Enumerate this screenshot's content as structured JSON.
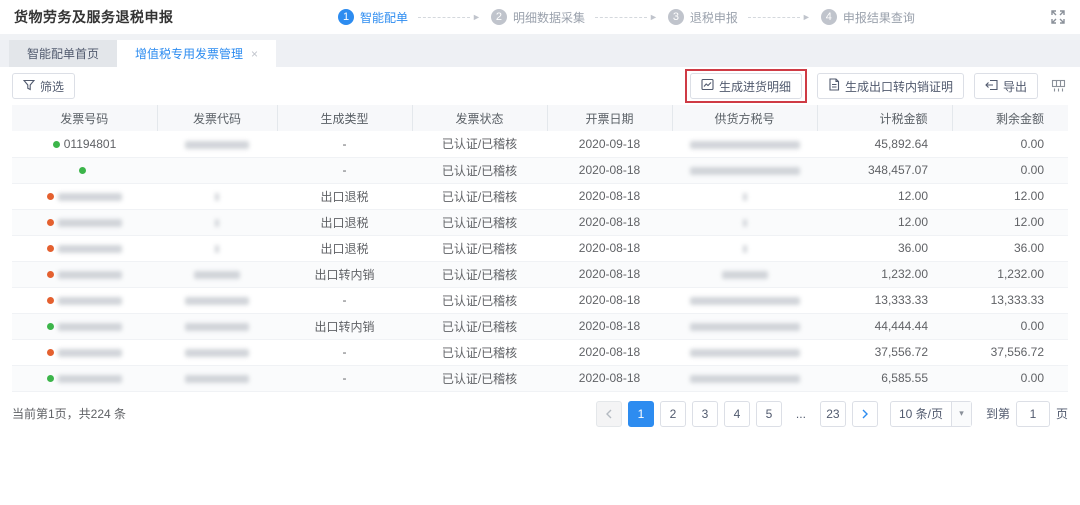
{
  "header": {
    "title": "货物劳务及服务退税申报",
    "steps": [
      {
        "num": "1",
        "label": "智能配单",
        "active": true
      },
      {
        "num": "2",
        "label": "明细数据采集",
        "active": false
      },
      {
        "num": "3",
        "label": "退税申报",
        "active": false
      },
      {
        "num": "4",
        "label": "申报结果查询",
        "active": false
      }
    ]
  },
  "tabs": [
    {
      "label": "智能配单首页",
      "active": false,
      "closable": false
    },
    {
      "label": "增值税专用发票管理",
      "active": true,
      "closable": true
    }
  ],
  "toolbar": {
    "filter_label": "筛选",
    "generate_purchase_label": "生成进货明细",
    "generate_export_label": "生成出口转内销证明",
    "export_label": "导出",
    "highlight_color": "#cf3b45",
    "accent_color": "#2d8cf0"
  },
  "table": {
    "columns": [
      "发票号码",
      "发票代码",
      "生成类型",
      "发票状态",
      "开票日期",
      "供货方税号",
      "计税金额",
      "剩余金额"
    ],
    "rows": [
      {
        "dot": "green",
        "number": {
          "text": "01194801"
        },
        "code": {
          "mask": "medium"
        },
        "type": "-",
        "status": "已认证/已稽核",
        "date": "2020-09-18",
        "supplier": {
          "mask": "long"
        },
        "tax_amount": "45,892.64",
        "remain_amount": "0.00"
      },
      {
        "dot": "green",
        "number": {},
        "code": {},
        "type": "-",
        "status": "已认证/已稽核",
        "date": "2020-08-18",
        "supplier": {
          "mask": "long"
        },
        "tax_amount": "348,457.07",
        "remain_amount": "0.00"
      },
      {
        "dot": "orange",
        "number": {
          "mask": "medium"
        },
        "code": {
          "mask": "tiny"
        },
        "type": "出口退税",
        "status": "已认证/已稽核",
        "date": "2020-08-18",
        "supplier": {
          "mask": "tiny"
        },
        "tax_amount": "12.00",
        "remain_amount": "12.00"
      },
      {
        "dot": "orange",
        "number": {
          "mask": "medium"
        },
        "code": {
          "mask": "tiny"
        },
        "type": "出口退税",
        "status": "已认证/已稽核",
        "date": "2020-08-18",
        "supplier": {
          "mask": "tiny"
        },
        "tax_amount": "12.00",
        "remain_amount": "12.00"
      },
      {
        "dot": "orange",
        "number": {
          "mask": "medium"
        },
        "code": {
          "mask": "tiny"
        },
        "type": "出口退税",
        "status": "已认证/已稽核",
        "date": "2020-08-18",
        "supplier": {
          "mask": "tiny"
        },
        "tax_amount": "36.00",
        "remain_amount": "36.00"
      },
      {
        "dot": "orange",
        "number": {
          "mask": "medium"
        },
        "code": {
          "mask": "small"
        },
        "type": "出口转内销",
        "status": "已认证/已稽核",
        "date": "2020-08-18",
        "supplier": {
          "mask": "small"
        },
        "tax_amount": "1,232.00",
        "remain_amount": "1,232.00"
      },
      {
        "dot": "orange",
        "number": {
          "mask": "medium"
        },
        "code": {
          "mask": "medium"
        },
        "type": "-",
        "status": "已认证/已稽核",
        "date": "2020-08-18",
        "supplier": {
          "mask": "long"
        },
        "tax_amount": "13,333.33",
        "remain_amount": "13,333.33"
      },
      {
        "dot": "green",
        "number": {
          "mask": "medium"
        },
        "code": {
          "mask": "medium"
        },
        "type": "出口转内销",
        "status": "已认证/已稽核",
        "date": "2020-08-18",
        "supplier": {
          "mask": "long"
        },
        "tax_amount": "44,444.44",
        "remain_amount": "0.00"
      },
      {
        "dot": "orange",
        "number": {
          "mask": "medium"
        },
        "code": {
          "mask": "medium"
        },
        "type": "-",
        "status": "已认证/已稽核",
        "date": "2020-08-18",
        "supplier": {
          "mask": "long"
        },
        "tax_amount": "37,556.72",
        "remain_amount": "37,556.72"
      },
      {
        "dot": "green",
        "number": {
          "mask": "medium"
        },
        "code": {
          "mask": "medium"
        },
        "type": "-",
        "status": "已认证/已稽核",
        "date": "2020-08-18",
        "supplier": {
          "mask": "long"
        },
        "tax_amount": "6,585.55",
        "remain_amount": "0.00"
      }
    ]
  },
  "pagination": {
    "summary": "当前第1页，共224 条",
    "pages": [
      "1",
      "2",
      "3",
      "4",
      "5",
      "...",
      "23"
    ],
    "active_page": "1",
    "page_size_label": "10 条/页",
    "goto_prefix": "到第",
    "goto_value": "1",
    "goto_suffix": "页"
  }
}
